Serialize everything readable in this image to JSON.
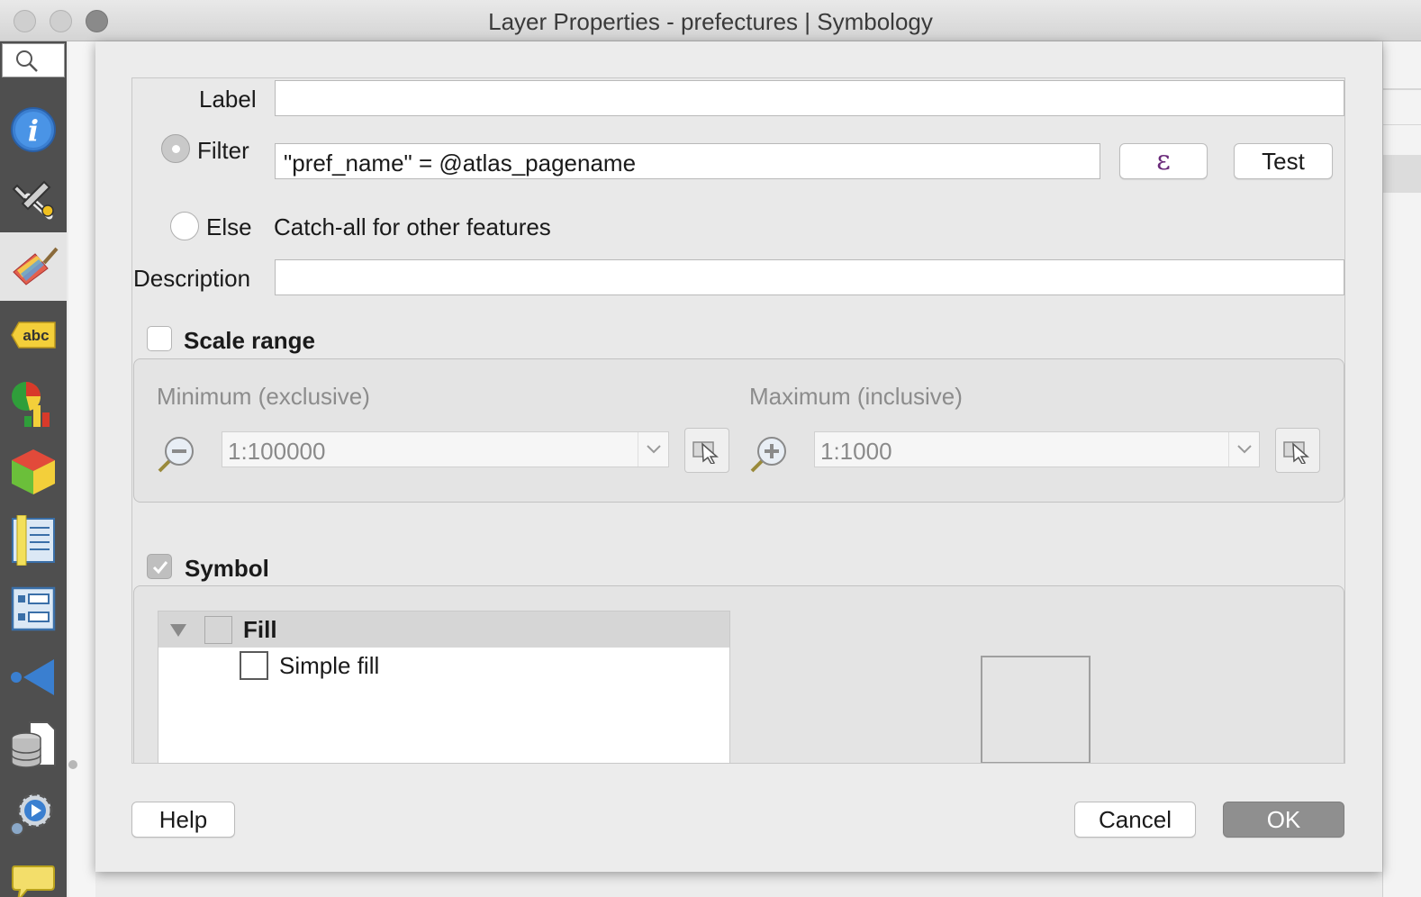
{
  "window": {
    "title": "Layer Properties - prefectures | Symbology"
  },
  "sidebar": {
    "items": [
      {
        "icon": "info-icon"
      },
      {
        "icon": "wrench-icon"
      },
      {
        "icon": "paintbrush-icon",
        "active": true
      },
      {
        "icon": "labels-icon",
        "text": "abc"
      },
      {
        "icon": "diagram-icon"
      },
      {
        "icon": "3d-cube-icon"
      },
      {
        "icon": "fields-icon"
      },
      {
        "icon": "attributes-form-icon"
      },
      {
        "icon": "joins-icon"
      },
      {
        "icon": "auxiliary-storage-icon"
      },
      {
        "icon": "actions-icon"
      },
      {
        "icon": "display-icon"
      }
    ]
  },
  "rule": {
    "label_caption": "Label",
    "label_value": "",
    "filter_caption": "Filter",
    "filter_value": "\"pref_name\" = @atlas_pagename",
    "expression_button": "ε",
    "test_button": "Test",
    "else_caption": "Else",
    "else_text": "Catch-all for other features",
    "description_caption": "Description",
    "description_value": "",
    "filter_selected": true
  },
  "scale_range": {
    "title": "Scale range",
    "checked": false,
    "minimum_caption": "Minimum (exclusive)",
    "minimum_value": "1:100000",
    "maximum_caption": "Maximum (inclusive)",
    "maximum_value": "1:1000"
  },
  "symbol": {
    "title": "Symbol",
    "checked": true,
    "tree": [
      {
        "label": "Fill",
        "expanded": true
      },
      {
        "label": "Simple fill"
      }
    ]
  },
  "footer": {
    "help": "Help",
    "cancel": "Cancel",
    "ok": "OK"
  },
  "colors": {
    "sidebar": "#4f4f4f",
    "ok_button": "#8f8f8f"
  }
}
